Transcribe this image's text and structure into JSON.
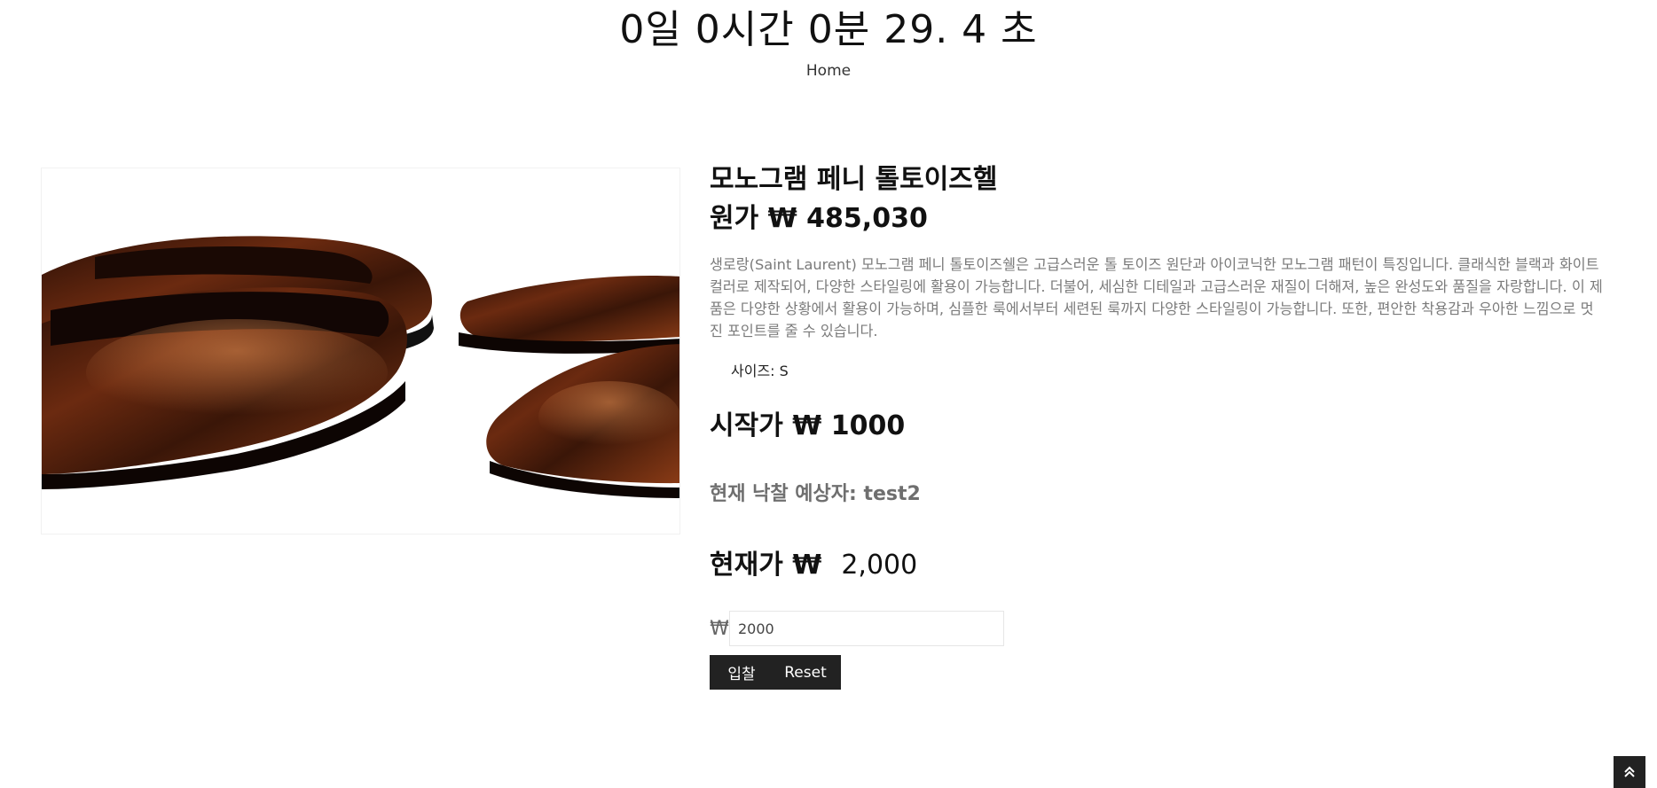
{
  "header": {
    "countdown": "0일 0시간 0분 29. 4 초",
    "breadcrumb": "Home"
  },
  "product": {
    "title": "모노그램 페니 톨토이즈헬",
    "original_price": "원가 ₩ 485,030",
    "description": "생로랑(Saint Laurent) 모노그램 페니 톨토이즈쉘은 고급스러운 톨 토이즈 원단과 아이코닉한 모노그램 패턴이 특징입니다. 클래식한 블랙과 화이트 컬러로 제작되어, 다양한 스타일링에 활용이 가능합니다. 더불어, 세심한 디테일과 고급스러운 재질이 더해져, 높은 완성도와 품질을 자랑합니다. 이 제품은 다양한 상황에서 활용이 가능하며, 심플한 룩에서부터 세련된 룩까지 다양한 스타일링이 가능합니다. 또한, 편안한 착용감과 우아한 느낌으로 멋진 포인트를 줄 수 있습니다.",
    "size_label": "사이즈: S",
    "start_price": "시작가 ₩ 1000",
    "current_bidder": "현재 낙찰 예상자: test2",
    "current_price_label": "현재가 ₩",
    "current_price_value": "2,000"
  },
  "bid_form": {
    "currency_symbol": "₩",
    "input_value": "2000",
    "bid_button": "입찰",
    "reset_button": "Reset"
  },
  "icons": {
    "scroll_top": "double-chevron-up-icon"
  },
  "colors": {
    "button_bg": "#222222",
    "description_text": "#7a7a7a",
    "bidder_text": "#6f6f6f"
  }
}
